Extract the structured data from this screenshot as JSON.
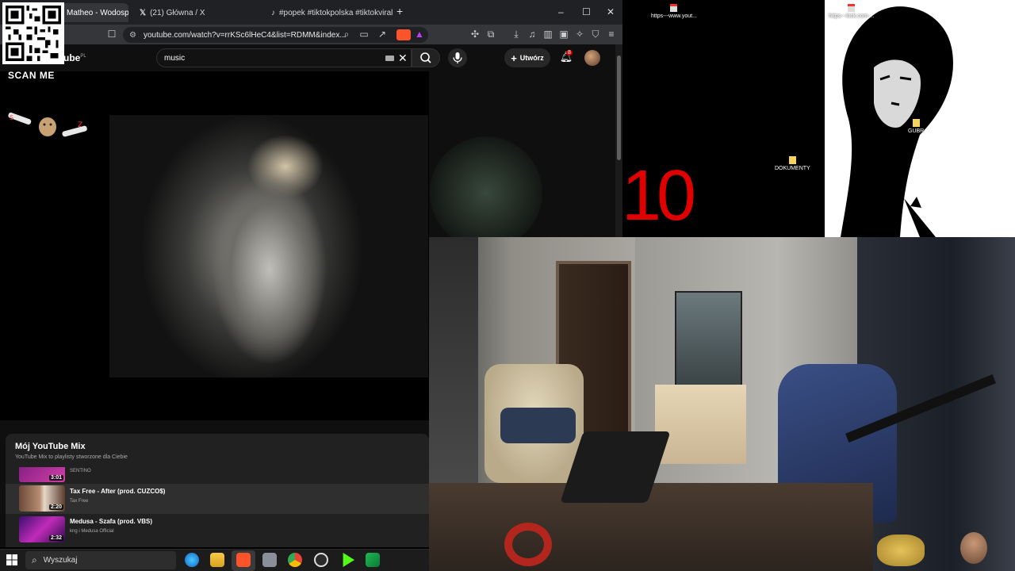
{
  "browser": {
    "tabs": [
      {
        "label": "Matheo - Wodosp",
        "active": true
      },
      {
        "label": "(21) Główna / X",
        "active": false
      },
      {
        "label": "#popek #tiktokpolska #tiktokviral #g",
        "active": false
      }
    ],
    "new_tab": "+",
    "window_controls": {
      "minimize": "–",
      "maximize": "☐",
      "close": "✕"
    },
    "url": "youtube.com/watch?v=rrKSc6lHeC4&list=RDMM&index..."
  },
  "youtube": {
    "logo": "ube",
    "region": "PL",
    "search_value": "music",
    "create_label": "Utwórz",
    "notification_count": "8",
    "playlist": {
      "title": "Mój YouTube Mix",
      "subtitle": "YouTube Mix to playlisty stworzone dla Ciebie",
      "items": [
        {
          "title": "",
          "artist": "SENTINO",
          "duration": "3:01"
        },
        {
          "title": "Tax Free - After (prod. CUZCO$)",
          "artist": "Tax Free",
          "duration": "2:20"
        },
        {
          "title": "Medusa - Szafa (prod. VBS)",
          "artist": "kng i Medusa Official",
          "duration": "2:32"
        }
      ]
    }
  },
  "overlay": {
    "scan_label": "SCAN ME"
  },
  "desktop": {
    "icons": [
      {
        "label": "https---www.yout..."
      },
      {
        "label": "https---kick.com-..."
      },
      {
        "label": "DOKUMENTY"
      },
      {
        "label": "GUBR"
      }
    ],
    "counter": "10"
  },
  "taskbar": {
    "search_placeholder": "Wyszukaj"
  },
  "colors": {
    "yt_bg": "#0f0f0f",
    "accent_red": "#e10000",
    "taskbar_bg": "#1c1c1c"
  }
}
